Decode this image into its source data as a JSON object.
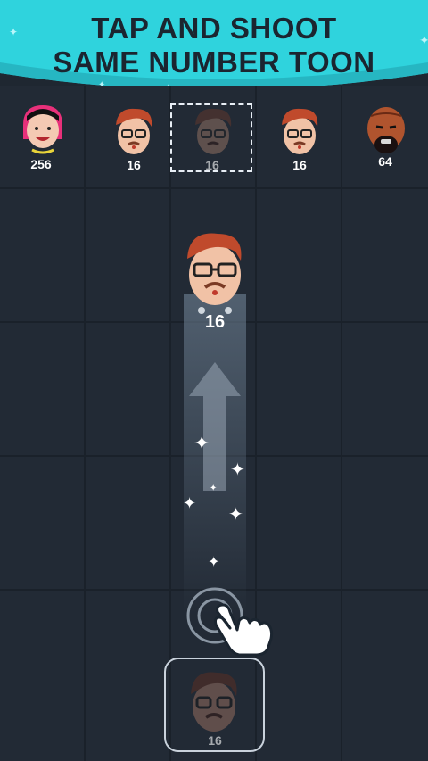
{
  "banner": {
    "line1": "TAP AND SHOOT",
    "line2": "SAME NUMBER TOON",
    "color": "#2fd3dd"
  },
  "top_row": [
    {
      "value": "256",
      "toon": "girl-pink-hair-icon"
    },
    {
      "value": "16",
      "toon": "guy-glasses-mustache-icon"
    },
    {
      "value": "16",
      "toon": "guy-glasses-mustache-icon",
      "highlighted": true
    },
    {
      "value": "16",
      "toon": "guy-glasses-mustache-icon"
    },
    {
      "value": "64",
      "toon": "bald-bearded-man-icon"
    }
  ],
  "flying_toon": {
    "value": "16",
    "toon": "guy-glasses-mustache-icon"
  },
  "shooter": {
    "value": "16",
    "toon": "guy-glasses-mustache-icon"
  },
  "hint": {
    "gesture": "tap-hand-icon",
    "direction": "up-arrow-icon"
  }
}
